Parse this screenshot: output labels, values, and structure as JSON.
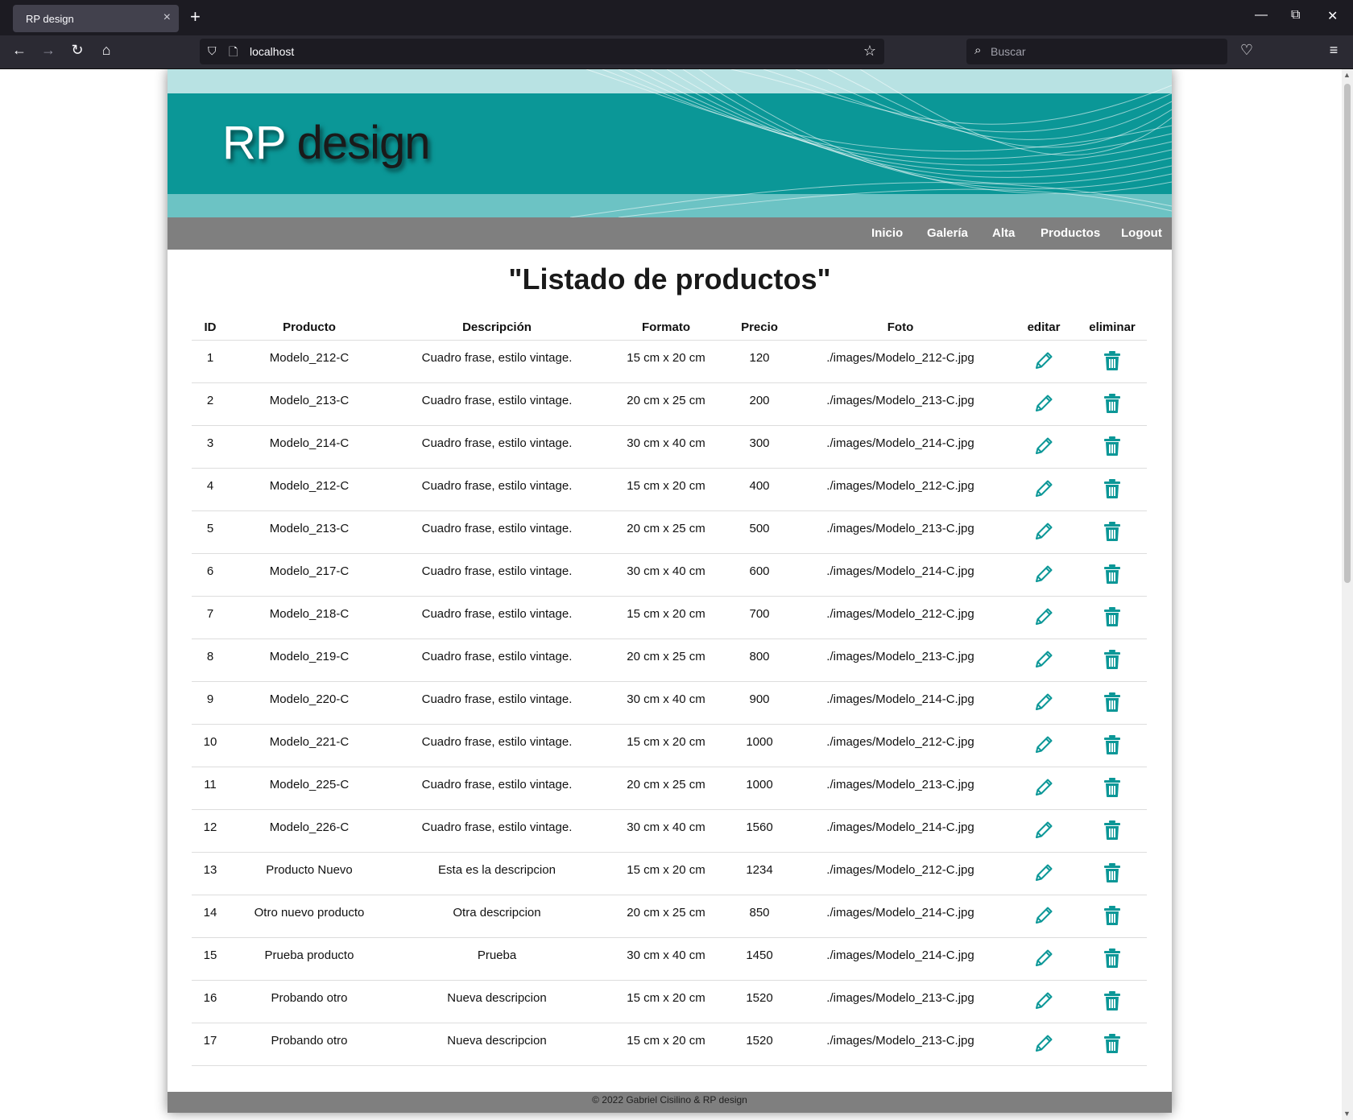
{
  "browser": {
    "tab_title": "RP design",
    "tab_close": "×",
    "new_tab": "+",
    "url": "localhost",
    "search_placeholder": "Buscar"
  },
  "site": {
    "brand_first": "RP",
    "brand_second": " design",
    "nav": [
      "Inicio",
      "Galería",
      "Alta",
      "Productos",
      "Logout"
    ]
  },
  "page": {
    "title": "\"Listado de productos\""
  },
  "table": {
    "headers": [
      "ID",
      "Producto",
      "Descripción",
      "Formato",
      "Precio",
      "Foto",
      "editar",
      "eliminar"
    ],
    "rows": [
      [
        "1",
        "Modelo_212-C",
        "Cuadro frase, estilo vintage.",
        "15 cm x 20 cm",
        "120",
        "./images/Modelo_212-C.jpg"
      ],
      [
        "2",
        "Modelo_213-C",
        "Cuadro frase, estilo vintage.",
        "20 cm x 25 cm",
        "200",
        "./images/Modelo_213-C.jpg"
      ],
      [
        "3",
        "Modelo_214-C",
        "Cuadro frase, estilo vintage.",
        "30 cm x 40 cm",
        "300",
        "./images/Modelo_214-C.jpg"
      ],
      [
        "4",
        "Modelo_212-C",
        "Cuadro frase, estilo vintage.",
        "15 cm x 20 cm",
        "400",
        "./images/Modelo_212-C.jpg"
      ],
      [
        "5",
        "Modelo_213-C",
        "Cuadro frase, estilo vintage.",
        "20 cm x 25 cm",
        "500",
        "./images/Modelo_213-C.jpg"
      ],
      [
        "6",
        "Modelo_217-C",
        "Cuadro frase, estilo vintage.",
        "30 cm x 40 cm",
        "600",
        "./images/Modelo_214-C.jpg"
      ],
      [
        "7",
        "Modelo_218-C",
        "Cuadro frase, estilo vintage.",
        "15 cm x 20 cm",
        "700",
        "./images/Modelo_212-C.jpg"
      ],
      [
        "8",
        "Modelo_219-C",
        "Cuadro frase, estilo vintage.",
        "20 cm x 25 cm",
        "800",
        "./images/Modelo_213-C.jpg"
      ],
      [
        "9",
        "Modelo_220-C",
        "Cuadro frase, estilo vintage.",
        "30 cm x 40 cm",
        "900",
        "./images/Modelo_214-C.jpg"
      ],
      [
        "10",
        "Modelo_221-C",
        "Cuadro frase, estilo vintage.",
        "15 cm x 20 cm",
        "1000",
        "./images/Modelo_212-C.jpg"
      ],
      [
        "11",
        "Modelo_225-C",
        "Cuadro frase, estilo vintage.",
        "20 cm x 25 cm",
        "1000",
        "./images/Modelo_213-C.jpg"
      ],
      [
        "12",
        "Modelo_226-C",
        "Cuadro frase, estilo vintage.",
        "30 cm x 40 cm",
        "1560",
        "./images/Modelo_214-C.jpg"
      ],
      [
        "13",
        "Producto Nuevo",
        "Esta es la descripcion",
        "15 cm x 20 cm",
        "1234",
        "./images/Modelo_212-C.jpg"
      ],
      [
        "14",
        "Otro nuevo producto",
        "Otra descripcion",
        "20 cm x 25 cm",
        "850",
        "./images/Modelo_214-C.jpg"
      ],
      [
        "15",
        "Prueba producto",
        "Prueba",
        "30 cm x 40 cm",
        "1450",
        "./images/Modelo_214-C.jpg"
      ],
      [
        "16",
        "Probando otro",
        "Nueva descripcion",
        "15 cm x 20 cm",
        "1520",
        "./images/Modelo_213-C.jpg"
      ],
      [
        "17",
        "Probando otro",
        "Nueva descripcion",
        "15 cm x 20 cm",
        "1520",
        "./images/Modelo_213-C.jpg"
      ]
    ]
  },
  "footer": {
    "text": "© 2022 Gabriel Cisilino & RP design"
  },
  "colors": {
    "accent": "#0b9797",
    "nav_bg": "#7f7f7f",
    "icon": "#0b9797"
  },
  "icons": {
    "edit": "pencil-icon",
    "delete": "trash-icon"
  }
}
